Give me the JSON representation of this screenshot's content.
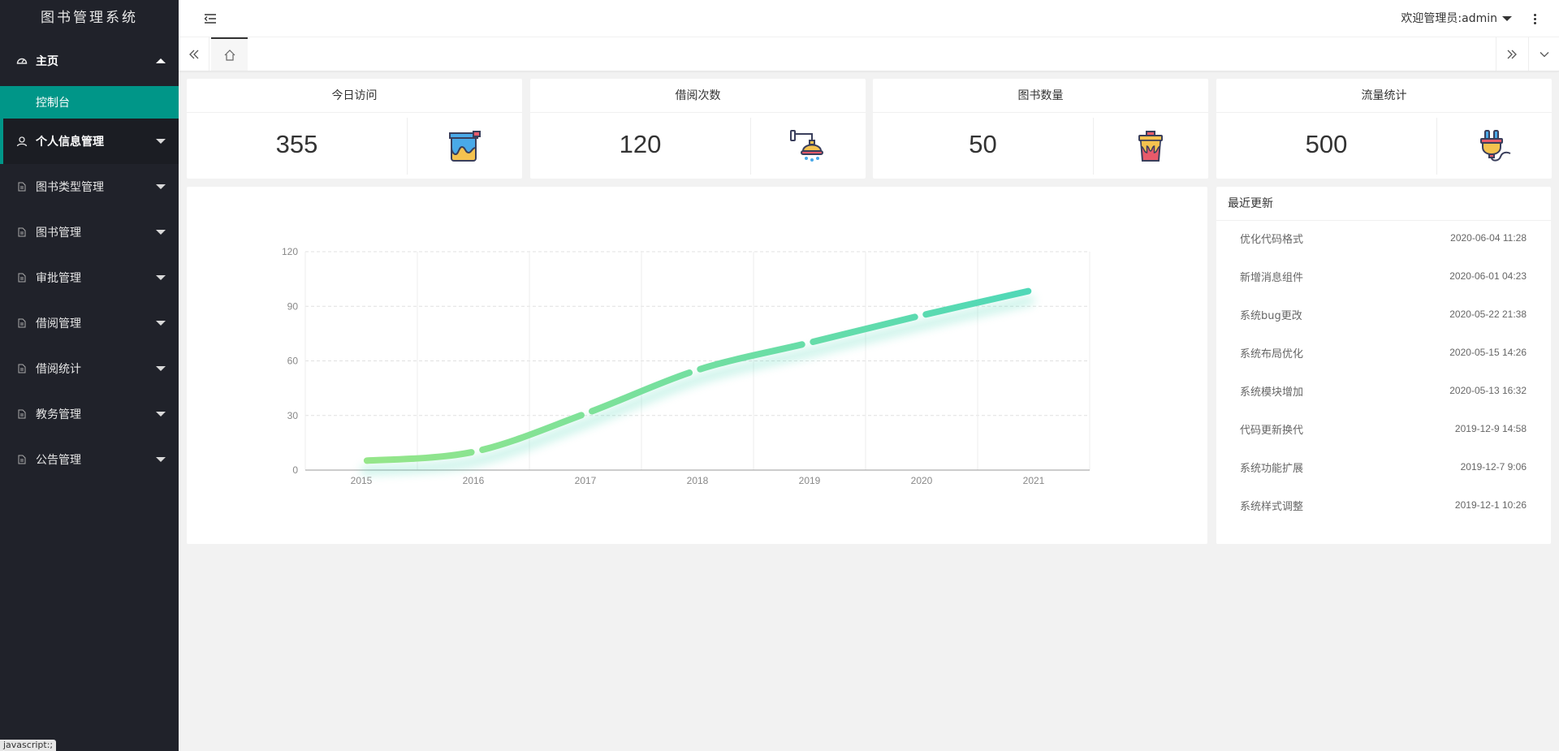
{
  "app": {
    "title": "图书管理系统"
  },
  "sidebar": {
    "home": {
      "label": "主页",
      "icon": "dashboard-icon"
    },
    "home_children": [
      {
        "label": "控制台"
      }
    ],
    "items": [
      {
        "label": "个人信息管理",
        "icon": "user-icon"
      },
      {
        "label": "图书类型管理",
        "icon": "file-icon"
      },
      {
        "label": "图书管理",
        "icon": "file-icon"
      },
      {
        "label": "审批管理",
        "icon": "file-icon"
      },
      {
        "label": "借阅管理",
        "icon": "file-icon"
      },
      {
        "label": "借阅统计",
        "icon": "file-icon"
      },
      {
        "label": "教务管理",
        "icon": "file-icon"
      },
      {
        "label": "公告管理",
        "icon": "file-icon"
      }
    ],
    "status_tip": "javascript:;"
  },
  "header": {
    "user_label": "欢迎管理员:admin"
  },
  "stats": [
    {
      "title": "今日访问",
      "value": "355",
      "icon": "paint-bucket-icon"
    },
    {
      "title": "借阅次数",
      "value": "120",
      "icon": "shower-icon"
    },
    {
      "title": "图书数量",
      "value": "50",
      "icon": "trash-bin-icon"
    },
    {
      "title": "流量统计",
      "value": "500",
      "icon": "plug-icon"
    }
  ],
  "updates": {
    "title": "最近更新",
    "items": [
      {
        "title": "优化代码格式",
        "time": "2020-06-04 11:28"
      },
      {
        "title": "新增消息组件",
        "time": "2020-06-01 04:23"
      },
      {
        "title": "系统bug更改",
        "time": "2020-05-22 21:38"
      },
      {
        "title": "系统布局优化",
        "time": "2020-05-15 14:26"
      },
      {
        "title": "系统模块增加",
        "time": "2020-05-13 16:32"
      },
      {
        "title": "代码更新换代",
        "time": "2019-12-9 14:58"
      },
      {
        "title": "系统功能扩展",
        "time": "2019-12-7 9:06"
      },
      {
        "title": "系统样式调整",
        "time": "2019-12-1 10:26"
      }
    ]
  },
  "chart_data": {
    "type": "line",
    "categories": [
      "2015",
      "2016",
      "2017",
      "2018",
      "2019",
      "2020",
      "2021"
    ],
    "series": [
      {
        "values": [
          5,
          10,
          31,
          55,
          70,
          85,
          99
        ]
      }
    ],
    "yticks": [
      "0",
      "30",
      "60",
      "90",
      "120"
    ],
    "ylim": [
      0,
      120
    ],
    "grid": true,
    "smooth": true,
    "colors": {
      "start": "#96e689",
      "end": "#4fd8b8"
    }
  }
}
